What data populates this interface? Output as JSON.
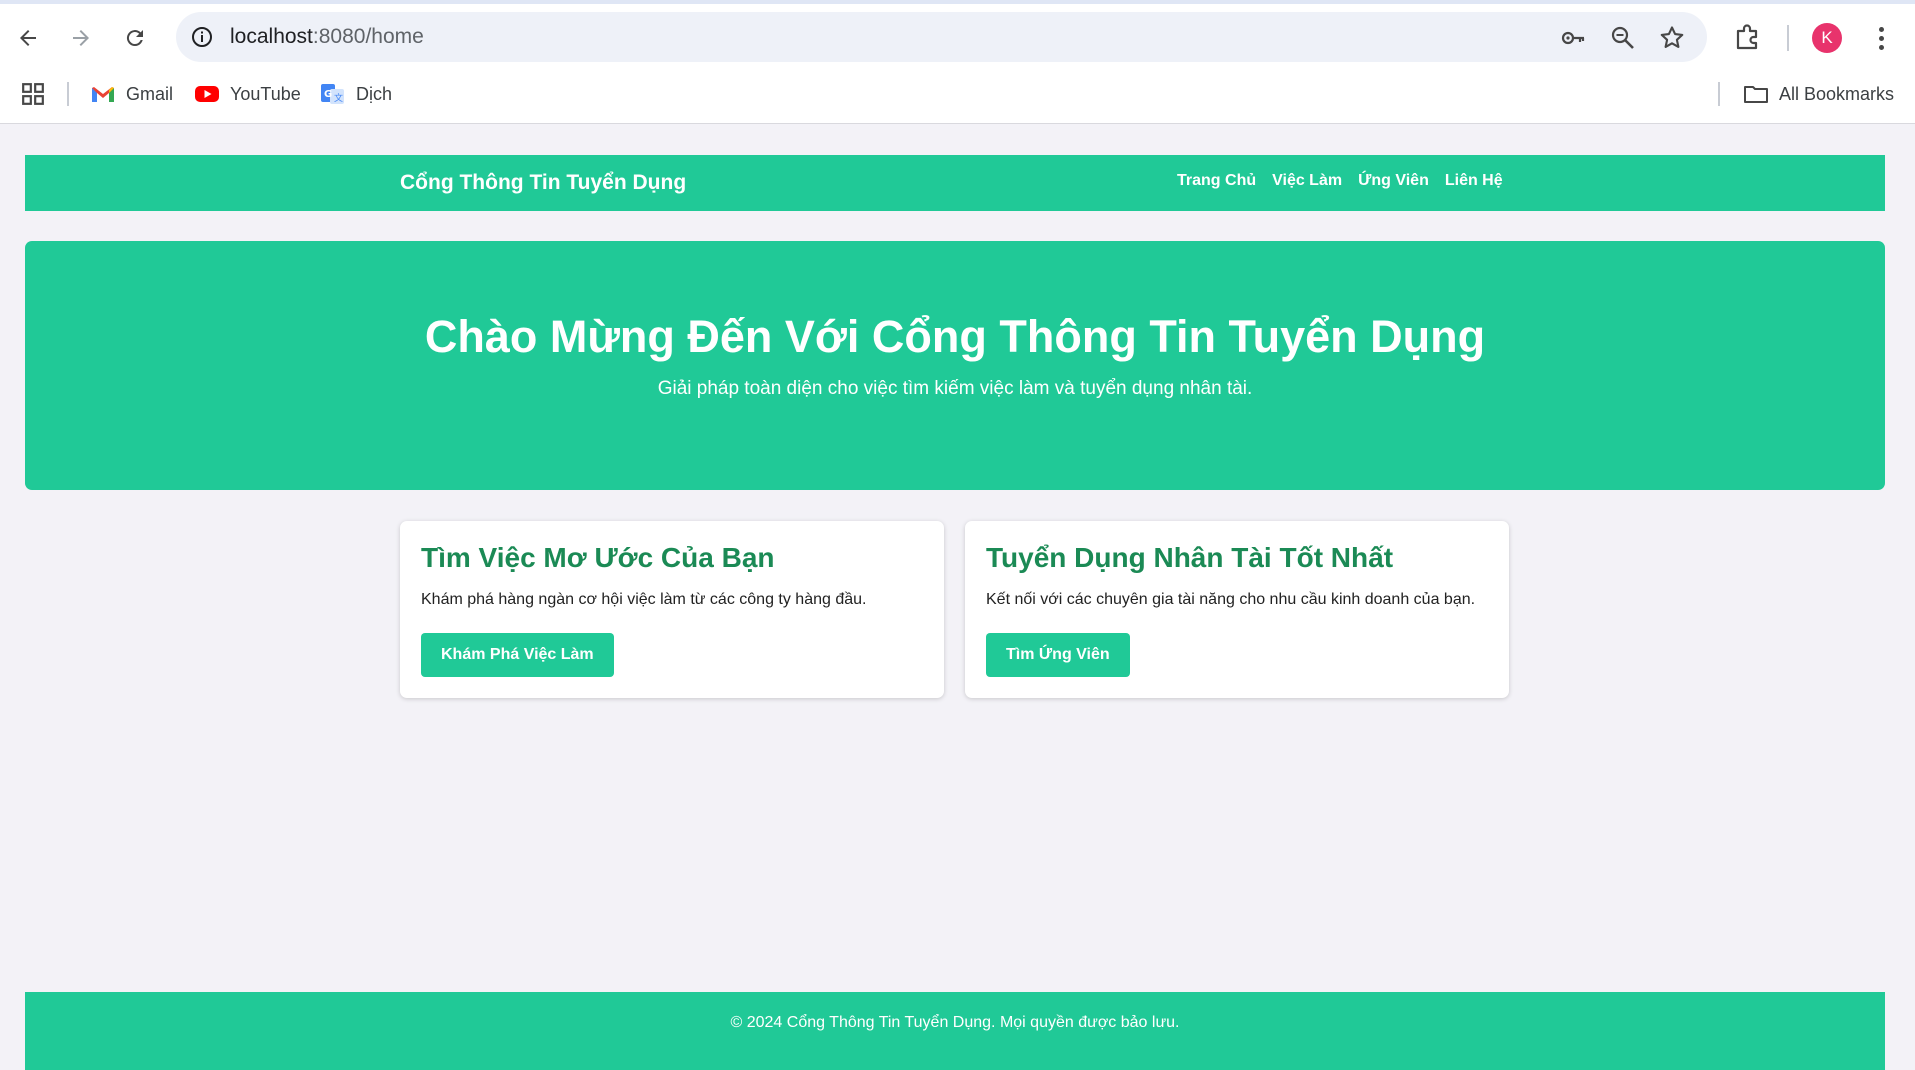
{
  "browser": {
    "url_host": "localhost",
    "url_path": ":8080/home",
    "profile_initial": "K",
    "bookmarks": [
      {
        "label": "Gmail",
        "icon": "gmail-icon"
      },
      {
        "label": "YouTube",
        "icon": "youtube-icon"
      },
      {
        "label": "Dịch",
        "icon": "translate-icon"
      }
    ],
    "all_bookmarks": "All Bookmarks"
  },
  "site": {
    "brand": "Cổng Thông Tin Tuyển Dụng",
    "nav": [
      "Trang Chủ",
      "Việc Làm",
      "Ứng Viên",
      "Liên Hệ"
    ]
  },
  "hero": {
    "title": "Chào Mừng Đến Với Cổng Thông Tin Tuyển Dụng",
    "subtitle": "Giải pháp toàn diện cho việc tìm kiếm việc làm và tuyển dụng nhân tài."
  },
  "cards": [
    {
      "title": "Tìm Việc Mơ Ước Của Bạn",
      "text": "Khám phá hàng ngàn cơ hội việc làm từ các công ty hàng đầu.",
      "button": "Khám Phá Việc Làm"
    },
    {
      "title": "Tuyển Dụng Nhân Tài Tốt Nhất",
      "text": "Kết nối với các chuyên gia tài năng cho nhu cầu kinh doanh của bạn.",
      "button": "Tìm Ứng Viên"
    }
  ],
  "footer": {
    "text": "© 2024 Cổng Thông Tin Tuyển Dụng. Mọi quyền được bảo lưu."
  },
  "colors": {
    "accent": "#20c997",
    "card_title": "#1b8a55",
    "page_bg": "#f3f2f7"
  }
}
